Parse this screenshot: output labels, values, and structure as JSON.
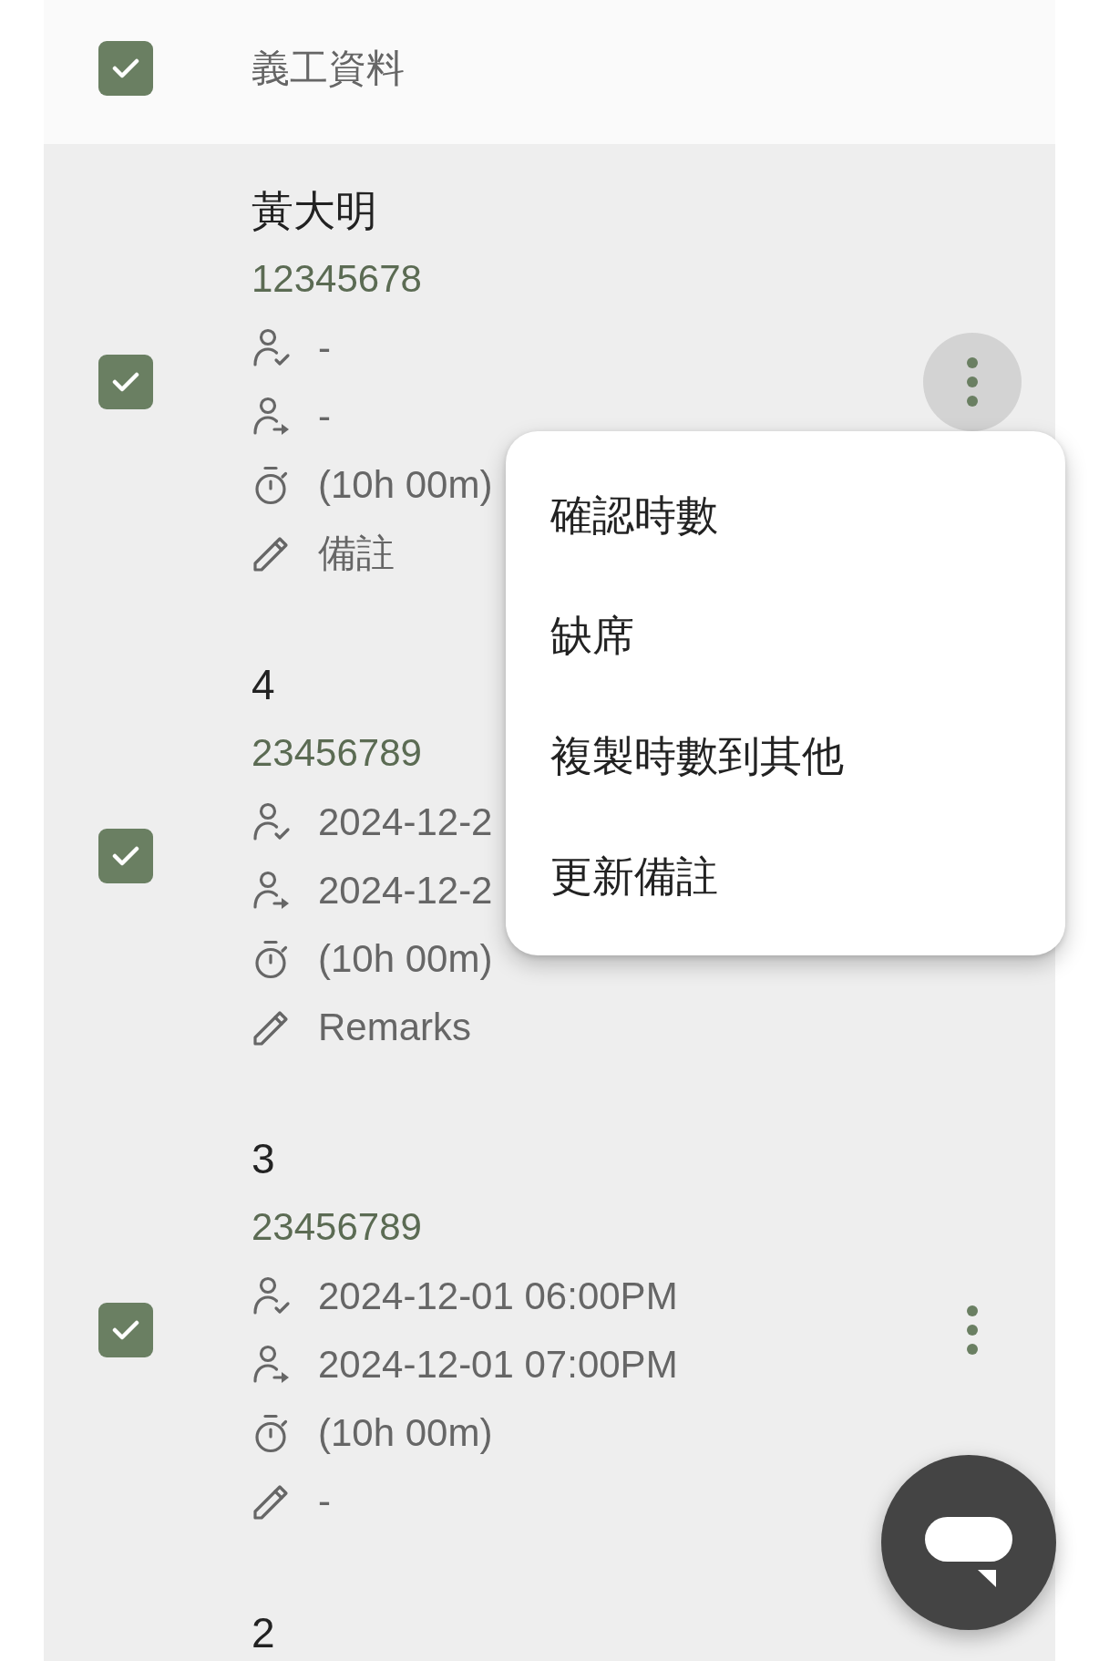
{
  "header": {
    "checked": true,
    "title": "義工資料"
  },
  "rows": [
    {
      "checked": true,
      "name": "黃大明",
      "number": "12345678",
      "menu_open": true,
      "details": [
        {
          "kind": "check_in",
          "text": "-"
        },
        {
          "kind": "check_out",
          "text": "-"
        },
        {
          "kind": "duration",
          "text": "(10h 00m)"
        },
        {
          "kind": "remarks",
          "text": "備註"
        }
      ]
    },
    {
      "checked": true,
      "name": "4",
      "number": "23456789",
      "details": [
        {
          "kind": "check_in",
          "text": "2024-12-2"
        },
        {
          "kind": "check_out",
          "text": "2024-12-2"
        },
        {
          "kind": "duration",
          "text": "(10h 00m)"
        },
        {
          "kind": "remarks",
          "text": "Remarks"
        }
      ]
    },
    {
      "checked": true,
      "name": "3",
      "number": "23456789",
      "menu_open": false,
      "details": [
        {
          "kind": "check_in",
          "text": "2024-12-01 06:00PM"
        },
        {
          "kind": "check_out",
          "text": "2024-12-01 07:00PM"
        },
        {
          "kind": "duration",
          "text": "(10h 00m)"
        },
        {
          "kind": "remarks",
          "text": "-"
        }
      ]
    },
    {
      "name": "2"
    }
  ],
  "menu": {
    "items": [
      "確認時數",
      "缺席",
      "複製時數到其他",
      "更新備註"
    ]
  }
}
